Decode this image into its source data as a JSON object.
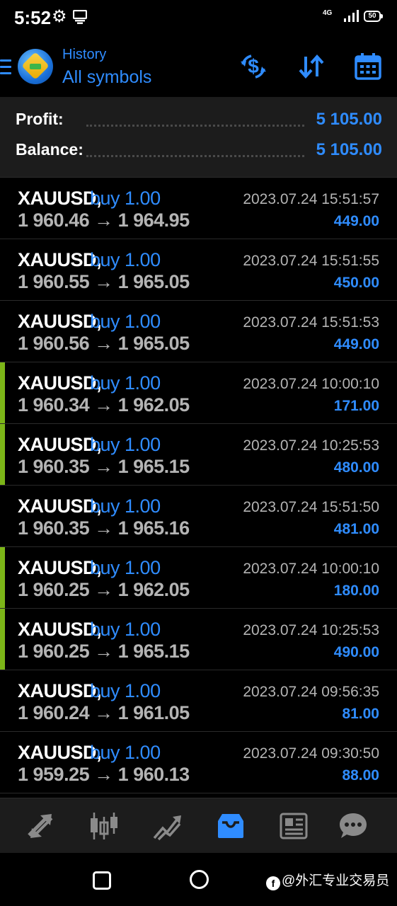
{
  "status_bar": {
    "time": "5:52",
    "network": "4G",
    "battery": "50"
  },
  "header": {
    "title": "History",
    "subtitle": "All symbols",
    "accent_color": "#2f8cff"
  },
  "summary": {
    "profit_label": "Profit:",
    "profit_value": "5 105.00",
    "balance_label": "Balance:",
    "balance_value": "5 105.00"
  },
  "deals": [
    {
      "symbol": "XAUUSD,",
      "type": "buy 1.00",
      "prices": "1 960.46 → 1 964.95",
      "time": "2023.07.24 15:51:57",
      "profit": "449.00",
      "marked": false
    },
    {
      "symbol": "XAUUSD,",
      "type": "buy 1.00",
      "prices": "1 960.55 → 1 965.05",
      "time": "2023.07.24 15:51:55",
      "profit": "450.00",
      "marked": false
    },
    {
      "symbol": "XAUUSD,",
      "type": "buy 1.00",
      "prices": "1 960.56 → 1 965.05",
      "time": "2023.07.24 15:51:53",
      "profit": "449.00",
      "marked": false
    },
    {
      "symbol": "XAUUSD,",
      "type": "buy 1.00",
      "prices": "1 960.34 → 1 962.05",
      "time": "2023.07.24 10:00:10",
      "profit": "171.00",
      "marked": true
    },
    {
      "symbol": "XAUUSD,",
      "type": "buy 1.00",
      "prices": "1 960.35 → 1 965.15",
      "time": "2023.07.24 10:25:53",
      "profit": "480.00",
      "marked": true
    },
    {
      "symbol": "XAUUSD,",
      "type": "buy 1.00",
      "prices": "1 960.35 → 1 965.16",
      "time": "2023.07.24 15:51:50",
      "profit": "481.00",
      "marked": false
    },
    {
      "symbol": "XAUUSD,",
      "type": "buy 1.00",
      "prices": "1 960.25 → 1 962.05",
      "time": "2023.07.24 10:00:10",
      "profit": "180.00",
      "marked": true
    },
    {
      "symbol": "XAUUSD,",
      "type": "buy 1.00",
      "prices": "1 960.25 → 1 965.15",
      "time": "2023.07.24 10:25:53",
      "profit": "490.00",
      "marked": true
    },
    {
      "symbol": "XAUUSD,",
      "type": "buy 1.00",
      "prices": "1 960.24 → 1 961.05",
      "time": "2023.07.24 09:56:35",
      "profit": "81.00",
      "marked": false
    },
    {
      "symbol": "XAUUSD,",
      "type": "buy 1.00",
      "prices": "1 959.25 → 1 960.13",
      "time": "2023.07.24 09:30:50",
      "profit": "88.00",
      "marked": false
    }
  ],
  "bottom_nav": [
    {
      "icon": "quotes-icon",
      "active": false
    },
    {
      "icon": "chart-icon",
      "active": false
    },
    {
      "icon": "trade-icon",
      "active": false
    },
    {
      "icon": "history-icon",
      "active": true
    },
    {
      "icon": "news-icon",
      "active": false
    },
    {
      "icon": "messages-icon",
      "active": false
    }
  ],
  "watermark": "@外汇专业交易员",
  "marker_color": "#7cb518"
}
